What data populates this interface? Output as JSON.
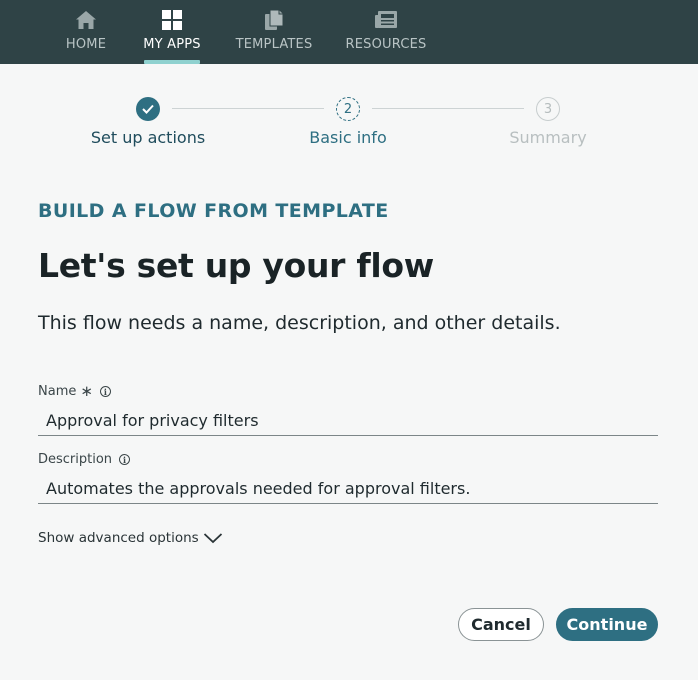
{
  "nav": {
    "items": [
      {
        "label": "HOME",
        "icon": "home-icon"
      },
      {
        "label": "MY APPS",
        "icon": "apps-grid-icon"
      },
      {
        "label": "TEMPLATES",
        "icon": "templates-icon"
      },
      {
        "label": "RESOURCES",
        "icon": "resources-icon"
      }
    ],
    "active": "MY APPS"
  },
  "stepper": {
    "steps": [
      {
        "label": "Set up actions",
        "number": "1",
        "status": "done"
      },
      {
        "label": "Basic info",
        "number": "2",
        "status": "current"
      },
      {
        "label": "Summary",
        "number": "3",
        "status": "future"
      }
    ]
  },
  "content": {
    "eyebrow": "BUILD A FLOW FROM TEMPLATE",
    "title": "Let's set up your flow",
    "subtitle": "This flow needs a name, description, and other details."
  },
  "form": {
    "name": {
      "label": "Name",
      "required_mark": "∗",
      "value": "Approval for privacy filters"
    },
    "description": {
      "label": "Description",
      "value": "Automates the approvals needed for approval filters."
    },
    "advanced_label": "Show advanced options"
  },
  "actions": {
    "cancel_label": "Cancel",
    "continue_label": "Continue"
  },
  "colors": {
    "nav_bg": "#2f4346",
    "accent": "#2e6f82",
    "active_underline": "#8fd1cf",
    "page_bg": "#f6f7f7"
  }
}
